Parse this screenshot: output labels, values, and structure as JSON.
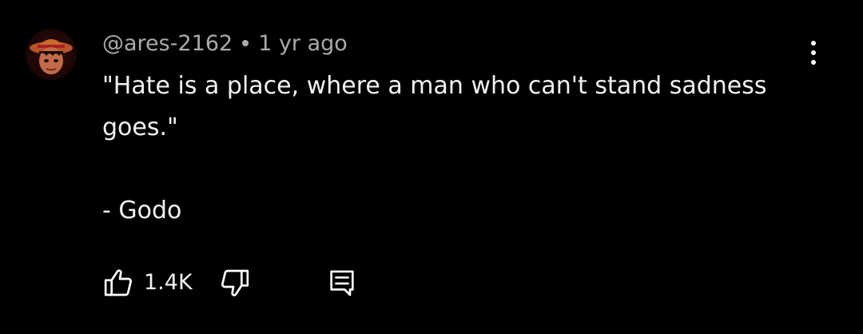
{
  "comment": {
    "author": "@ares-2162",
    "time": "1 yr ago",
    "text_lines": [
      "\"Hate is a place, where a man who can't stand sadness",
      "goes.\""
    ],
    "signature": "- Godo",
    "like_count": "1.4K"
  },
  "icons": {
    "avatar": "avatar-image",
    "menu": "more-vert-icon",
    "like": "thumb-up-icon",
    "dislike": "thumb-down-icon",
    "reply": "comment-icon"
  },
  "colors": {
    "background": "#000000",
    "text": "#f1f1f1",
    "meta": "#aaaaaa"
  }
}
